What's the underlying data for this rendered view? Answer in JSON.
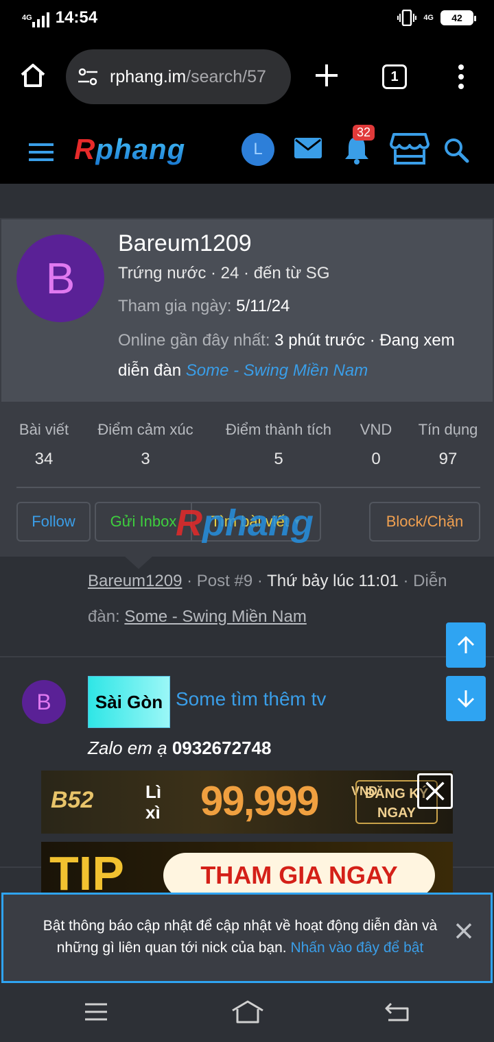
{
  "status_bar": {
    "network": "4G",
    "time": "14:54",
    "network_right": "4G",
    "battery": "42"
  },
  "browser": {
    "url_host": "rphang.im",
    "url_path": "/search/57",
    "tab_count": "1"
  },
  "site_header": {
    "logo_r": "R",
    "logo_rest": "phang",
    "user_initial": "L",
    "alert_count": "32"
  },
  "profile": {
    "avatar_initial": "B",
    "username": "Bareum1209",
    "title_line": "Trứng nước · 24 · đến từ SG",
    "joined_label": "Tham gia ngày:",
    "joined_value": "5/11/24",
    "online_label": "Online gần đây nhất:",
    "online_value": "3 phút trước · Đang xem",
    "viewing_prefix": "diễn đàn",
    "viewing_link": "Some - Swing Miền Nam"
  },
  "stats": [
    {
      "label": "Bài viết",
      "value": "34"
    },
    {
      "label": "Điểm cảm xúc",
      "value": "3"
    },
    {
      "label": "Điểm thành tích",
      "value": "5"
    },
    {
      "label": "VND",
      "value": "0"
    },
    {
      "label": "Tín dụng",
      "value": "97"
    }
  ],
  "actions": {
    "follow": "Follow",
    "inbox": "Gửi Inbox",
    "find_posts": "Tìm bài viết",
    "block": "Block/Chặn"
  },
  "post_meta": {
    "author": "Bareum1209",
    "post_no": "Post #9",
    "time": "Thứ bảy lúc 11:01",
    "forum_prefix": "Diễn đàn:",
    "forum": "Some - Swing Miền Nam"
  },
  "thread": {
    "avatar_initial": "B",
    "prefix_tag": "Sài Gòn",
    "title": "Some tìm thêm tv",
    "body_italic": "Zalo em ạ",
    "body_bold": "0932672748"
  },
  "ads": {
    "ad1_brand": "B52",
    "ad1_lixi": "Lì xì",
    "ad1_amount": "99,999",
    "ad1_unit": "VND",
    "ad1_cta": "ĐĂNG KÝ NGAY",
    "ad2_brand": "TIP",
    "ad2_cta": "THAM GIA NGAY"
  },
  "notification": {
    "text": "Bật thông báo cập nhật để cập nhật về hoạt động diễn đàn và những gì liên quan tới nick của bạn.",
    "link": "Nhấn vào đây để bật"
  },
  "colors": {
    "accent": "#2fa4f2",
    "link": "#3a9ee8",
    "follow": "#3a9ee8",
    "inbox": "#3ecf3e",
    "find": "#e8d040",
    "block": "#f0a050"
  }
}
